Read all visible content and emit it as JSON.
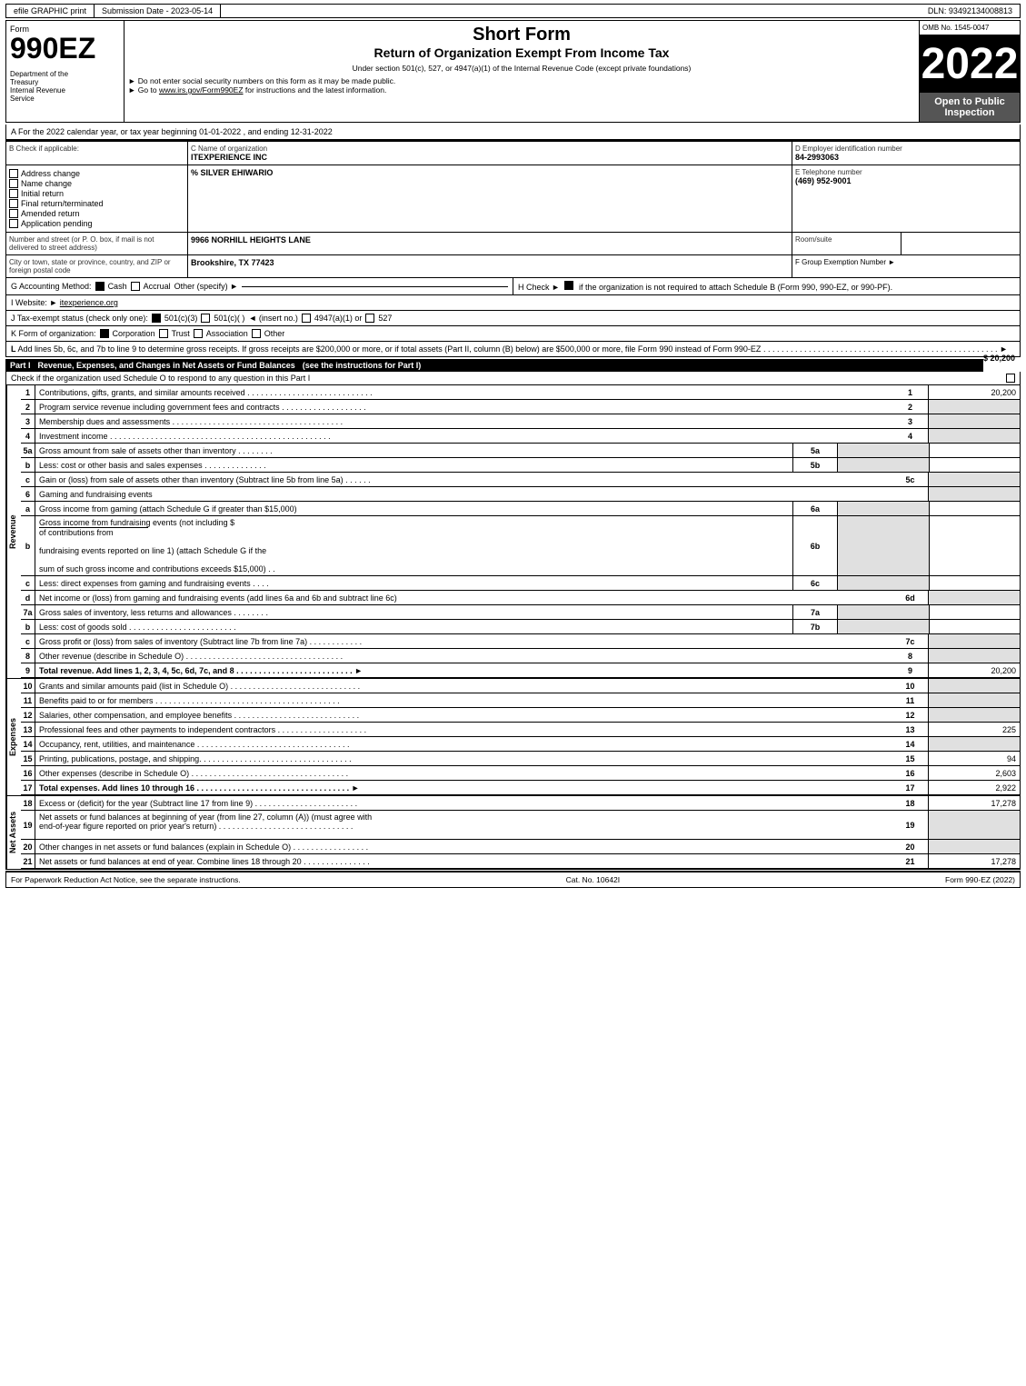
{
  "topBar": {
    "efile": "efile GRAPHIC print",
    "submission": "Submission Date - 2023-05-14",
    "dln": "DLN: 93492134008813"
  },
  "header": {
    "formLabel": "Form",
    "formNumber": "990EZ",
    "deptLine1": "Department of the",
    "deptLine2": "Treasury",
    "deptLine3": "Internal Revenue",
    "deptLine4": "Service",
    "title1": "Short Form",
    "title2": "Return of Organization Exempt From Income Tax",
    "subtitle": "Under section 501(c), 527, or 4947(a)(1) of the Internal Revenue Code (except private foundations)",
    "note1": "► Do not enter social security numbers on this form as it may be made public.",
    "note2": "► Go to www.irs.gov/Form990EZ for instructions and the latest information.",
    "link": "www.irs.gov/Form990EZ",
    "year": "2022",
    "omb": "OMB No. 1545-0047",
    "openPublic": "Open to Public Inspection"
  },
  "sectionA": {
    "text": "A For the 2022 calendar year, or tax year beginning 01-01-2022 , and ending 12-31-2022"
  },
  "sectionB": {
    "label": "B Check if applicable:",
    "items": [
      {
        "label": "Address change",
        "checked": false
      },
      {
        "label": "Name change",
        "checked": false
      },
      {
        "label": "Initial return",
        "checked": false
      },
      {
        "label": "Final return/terminated",
        "checked": false
      },
      {
        "label": "Amended return",
        "checked": false
      },
      {
        "label": "Application pending",
        "checked": false
      }
    ]
  },
  "sectionC": {
    "label": "C Name of organization",
    "name": "ITEXPERIENCE INC",
    "careOf": "% SILVER EHIWARIO",
    "addressLabel": "Number and street (or P. O. box, if mail is not delivered to street address)",
    "address": "9966 NORHILL HEIGHTS LANE",
    "roomLabel": "Room/suite",
    "room": "",
    "cityLabel": "City or town, state or province, country, and ZIP or foreign postal code",
    "city": "Brookshire, TX  77423"
  },
  "sectionD": {
    "label": "D Employer identification number",
    "ein": "84-2993063",
    "phoneLabel": "E Telephone number",
    "phone": "(469) 952-9001",
    "groupLabel": "F Group Exemption Number",
    "groupArrow": "►"
  },
  "sectionG": {
    "label": "G Accounting Method:",
    "cashChecked": true,
    "accrualChecked": false,
    "otherLabel": "Other (specify) ►"
  },
  "sectionH": {
    "text": "H Check ►",
    "checkChecked": true,
    "desc": "if the organization is not required to attach Schedule B (Form 990, 990-EZ, or 990-PF)."
  },
  "sectionI": {
    "label": "I Website: ►",
    "url": "itexperience.org"
  },
  "sectionJ": {
    "label": "J Tax-exempt status (check only one):",
    "options": [
      "501(c)(3)",
      "501(c)(  )",
      "◄ (insert no.)",
      "4947(a)(1) or",
      "527"
    ],
    "checked501c3": true
  },
  "sectionK": {
    "label": "K Form of organization:",
    "options": [
      "Corporation",
      "Trust",
      "Association",
      "Other"
    ],
    "checkedCorp": true
  },
  "sectionL": {
    "text": "L Add lines 5b, 6c, and 7b to line 9 to determine gross receipts. If gross receipts are $200,000 or more, or if total assets (Part II, column (B) below) are $500,000 or more, file Form 990 instead of Form 990-EZ",
    "dots": ". . . . . . . . . . . . . . . . . . . . . . . . . . . . . . . . . . . . . . . . . . . . . . . . . . . .",
    "arrow": "►",
    "amount": "$ 20,200"
  },
  "partI": {
    "title": "Part I",
    "desc": "Revenue, Expenses, and Changes in Net Assets or Fund Balances",
    "note": "(see the instructions for Part I)",
    "checkText": "Check if the organization used Schedule O to respond to any question in this Part I",
    "lines": [
      {
        "num": "1",
        "desc": "Contributions, gifts, grants, and similar amounts received",
        "dots": true,
        "lineNum": "1",
        "amount": "20,200"
      },
      {
        "num": "2",
        "desc": "Program service revenue including government fees and contracts",
        "dots": true,
        "lineNum": "2",
        "amount": ""
      },
      {
        "num": "3",
        "desc": "Membership dues and assessments",
        "dots": true,
        "lineNum": "3",
        "amount": ""
      },
      {
        "num": "4",
        "desc": "Investment income",
        "dots": true,
        "lineNum": "4",
        "amount": ""
      },
      {
        "num": "5a",
        "desc": "Gross amount from sale of assets other than inventory",
        "ref": "5a",
        "dots": true,
        "lineNum": "",
        "amount": ""
      },
      {
        "num": "b",
        "desc": "Less: cost or other basis and sales expenses",
        "ref": "5b",
        "dots": true,
        "lineNum": "",
        "amount": ""
      },
      {
        "num": "c",
        "desc": "Gain or (loss) from sale of assets other than inventory (Subtract line 5b from line 5a)",
        "dots": true,
        "lineNum": "5c",
        "amount": ""
      },
      {
        "num": "6",
        "desc": "Gaming and fundraising events",
        "dots": false,
        "lineNum": "",
        "amount": ""
      },
      {
        "num": "a",
        "desc": "Gross income from gaming (attach Schedule G if greater than $15,000)",
        "ref": "6a",
        "dots": false,
        "lineNum": "",
        "amount": ""
      },
      {
        "num": "b",
        "desc": "Gross income from fundraising events (not including $___________of contributions from fundraising events reported on line 1) (attach Schedule G if the sum of such gross income and contributions exceeds $15,000)",
        "ref": "6b",
        "dots": false,
        "lineNum": "",
        "amount": ""
      },
      {
        "num": "c",
        "desc": "Less: direct expenses from gaming and fundraising events",
        "ref": "6c",
        "dots": true,
        "lineNum": "",
        "amount": ""
      },
      {
        "num": "d",
        "desc": "Net income or (loss) from gaming and fundraising events (add lines 6a and 6b and subtract line 6c)",
        "dots": false,
        "lineNum": "6d",
        "amount": ""
      },
      {
        "num": "7a",
        "desc": "Gross sales of inventory, less returns and allowances",
        "ref": "7a",
        "dots": true,
        "lineNum": "",
        "amount": ""
      },
      {
        "num": "b",
        "desc": "Less: cost of goods sold",
        "ref": "7b",
        "dots": true,
        "lineNum": "",
        "amount": ""
      },
      {
        "num": "c",
        "desc": "Gross profit or (loss) from sales of inventory (Subtract line 7b from line 7a)",
        "dots": true,
        "lineNum": "7c",
        "amount": ""
      },
      {
        "num": "8",
        "desc": "Other revenue (describe in Schedule O)",
        "dots": true,
        "lineNum": "8",
        "amount": ""
      },
      {
        "num": "9",
        "desc": "Total revenue. Add lines 1, 2, 3, 4, 5c, 6d, 7c, and 8",
        "dots": true,
        "bold": true,
        "arrow": "►",
        "lineNum": "9",
        "amount": "20,200"
      }
    ]
  },
  "partIExpenses": {
    "lines": [
      {
        "num": "10",
        "desc": "Grants and similar amounts paid (list in Schedule O)",
        "dots": true,
        "lineNum": "10",
        "amount": ""
      },
      {
        "num": "11",
        "desc": "Benefits paid to or for members",
        "dots": true,
        "lineNum": "11",
        "amount": ""
      },
      {
        "num": "12",
        "desc": "Salaries, other compensation, and employee benefits",
        "dots": true,
        "lineNum": "12",
        "amount": ""
      },
      {
        "num": "13",
        "desc": "Professional fees and other payments to independent contractors",
        "dots": true,
        "lineNum": "13",
        "amount": "225"
      },
      {
        "num": "14",
        "desc": "Occupancy, rent, utilities, and maintenance",
        "dots": true,
        "lineNum": "14",
        "amount": ""
      },
      {
        "num": "15",
        "desc": "Printing, publications, postage, and shipping",
        "dots": true,
        "lineNum": "15",
        "amount": "94"
      },
      {
        "num": "16",
        "desc": "Other expenses (describe in Schedule O)",
        "dots": true,
        "lineNum": "16",
        "amount": "2,603"
      },
      {
        "num": "17",
        "desc": "Total expenses. Add lines 10 through 16",
        "dots": true,
        "bold": true,
        "arrow": "►",
        "lineNum": "17",
        "amount": "2,922"
      }
    ]
  },
  "partINetAssets": {
    "lines": [
      {
        "num": "18",
        "desc": "Excess or (deficit) for the year (Subtract line 17 from line 9)",
        "dots": true,
        "lineNum": "18",
        "amount": "17,278"
      },
      {
        "num": "19",
        "desc": "Net assets or fund balances at beginning of year (from line 27, column (A)) (must agree with end-of-year figure reported on prior year's return)",
        "dots": true,
        "lineNum": "19",
        "amount": ""
      },
      {
        "num": "20",
        "desc": "Other changes in net assets or fund balances (explain in Schedule O)",
        "dots": true,
        "lineNum": "20",
        "amount": ""
      },
      {
        "num": "21",
        "desc": "Net assets or fund balances at end of year. Combine lines 18 through 20",
        "dots": true,
        "lineNum": "21",
        "amount": "17,278"
      }
    ]
  },
  "footer": {
    "left": "For Paperwork Reduction Act Notice, see the separate instructions.",
    "cat": "Cat. No. 10642I",
    "right": "Form 990-EZ (2022)"
  }
}
